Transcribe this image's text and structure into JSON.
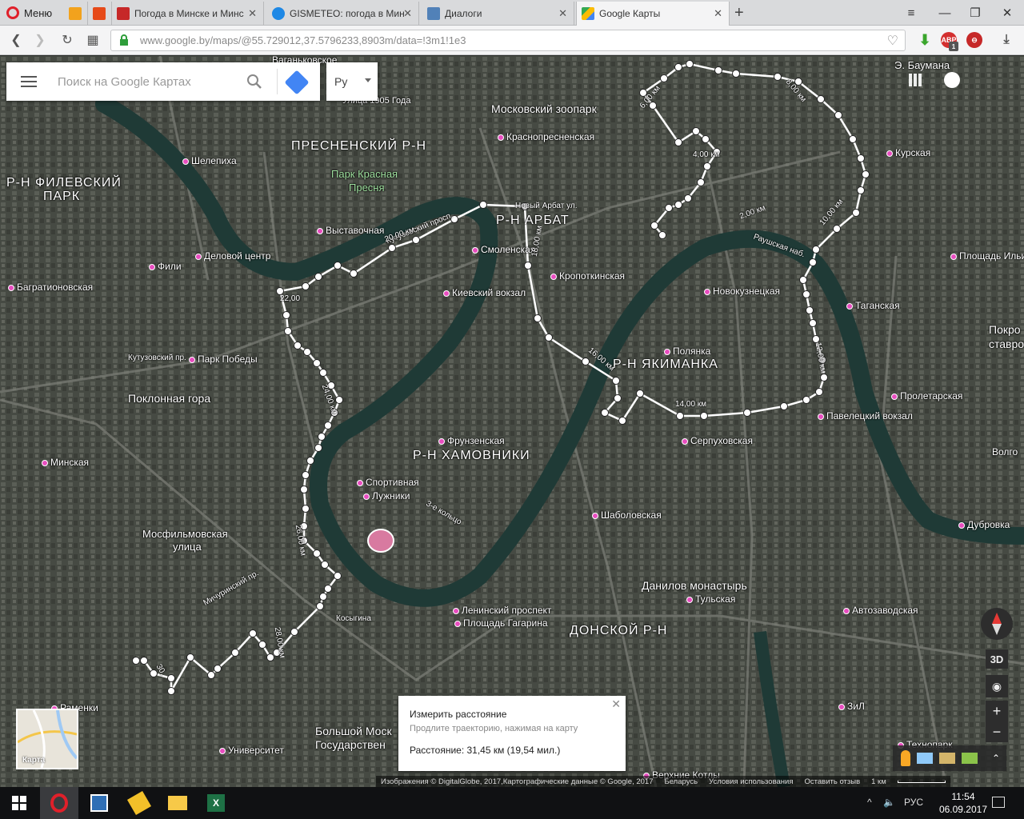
{
  "browser": {
    "menu_label": "Меню",
    "tabs": [
      {
        "title": "Погода в Минске и Минс",
        "active": false
      },
      {
        "title": "GISMETEO: погода в Мин",
        "active": false
      },
      {
        "title": "Диалоги",
        "active": false
      },
      {
        "title": "Google Карты",
        "active": true
      }
    ],
    "url": "www.google.by/maps/@55.729012,37.5796233,8903m/data=!3m1!1e3",
    "abp_badge": "1"
  },
  "search": {
    "placeholder": "Поиск на Google Картах",
    "lang": "Ру"
  },
  "map_labels": {
    "districts": [
      "ПРЕСНЕНСКИЙ Р-Н",
      "Р-Н ФИЛЕВСКИЙ",
      "ПАРК",
      "Р-Н АРБАТ",
      "Р-Н ЯКИМАНКА",
      "Р-Н ХАМОВНИКИ",
      "ДОНСКОЙ Р-Н"
    ],
    "places": [
      "Московский зоопарк",
      "Краснопресненская",
      "Шелепиха",
      "Парк Красная",
      "Пресня",
      "Выставочная",
      "Деловой центр",
      "Фили",
      "Багратионовская",
      "Смоленская",
      "Киевский вокзал",
      "Кропоткинская",
      "Новокузнецкая",
      "Таганская",
      "Площадь Ильича",
      "Курская",
      "Э. Баумана",
      "Парк Победы",
      "Поклонная гора",
      "Кутузовский пр.",
      "Полянка",
      "Пролетарская",
      "Павелецкий вокзал",
      "Фрунзенская",
      "Спортивная",
      "Лужники",
      "Серпуховская",
      "Шаболовская",
      "Минская",
      "Мосфильмовская",
      "улица",
      "Данилов монастырь",
      "Тульская",
      "Ленинский проспект",
      "Площадь Гагарина",
      "Автозаводская",
      "Дубровка",
      "ЗиЛ",
      "Большой Моск",
      "Государствен",
      "Университет",
      "Раменки",
      "Верхние Котлы",
      "Технопарк",
      "Улица 1905 Года",
      "Ваганьковское",
      "Новый Арбат ул.",
      "Раушская наб.",
      "Косыгина",
      "3-е кольцо",
      "Покро",
      "ставро",
      "Волго",
      "Мичуринский пр.",
      "Кутузовский просп."
    ],
    "distances": [
      "2,00 км",
      "4,00 км",
      "6,00 км",
      "8,00 км",
      "10,00 км",
      "12,00 км",
      "14,00 км",
      "16,00 км",
      "18,00 км",
      "20,00 км",
      "22,00",
      "24,00 км",
      "26,00 км",
      "28,00 км",
      "30,"
    ]
  },
  "measure": {
    "title": "Измерить расстояние",
    "hint": "Продлите траекторию, нажимая на карту",
    "distance": "Расстояние: 31,45 км (19,54 мил.)"
  },
  "minimap_label": "Карта",
  "controls": {
    "three_d": "3D",
    "zoom_in": "+",
    "zoom_out": "−"
  },
  "attribution": [
    "Изображения © DigitalGlobe, 2017,Картографические данные © Google, 2017",
    "Беларусь",
    "Условия использования",
    "Оставить отзыв",
    "1 км"
  ],
  "taskbar": {
    "lang": "РУС",
    "time": "11:54",
    "date": "06.09.2017"
  },
  "colors": {
    "route": "#ffffff",
    "river": "#1f3a36",
    "opera_red": "#e0202a",
    "maps_blue": "#4285f4"
  }
}
